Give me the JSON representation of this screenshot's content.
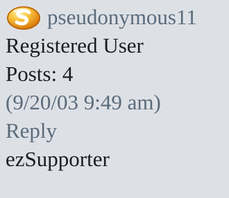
{
  "user": {
    "icon": "user-status-orb-icon",
    "username": "pseudonymous11",
    "rank": "Registered User",
    "posts": "Posts: 4"
  },
  "post": {
    "date": "(9/20/03 9:49 am)",
    "reply_label": "Reply"
  },
  "badge": {
    "label": "ezSupporter"
  },
  "colors": {
    "background": "#dde1e6",
    "link": "#5b6b7b",
    "text": "#1b1d20",
    "icon_orange": "#f1a31a"
  }
}
